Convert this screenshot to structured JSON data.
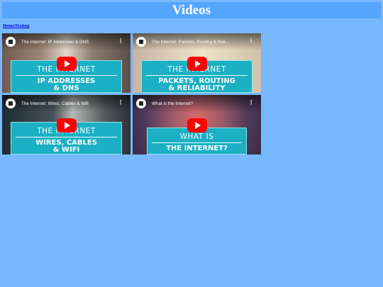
{
  "page": {
    "title": "Videos"
  },
  "nav": {
    "links": [
      "Home",
      "Texting"
    ]
  },
  "videos": [
    {
      "title": "The Internet: IP Addresses & DNS",
      "card_top": "THE INTERNET",
      "card_main_1": "IP ADDRESSES",
      "card_main_2": "& DNS"
    },
    {
      "title": "The Internet: Packets, Routing & Reli...",
      "card_top": "THE INTERNET",
      "card_main_1": "PACKETS, ROUTING",
      "card_main_2": "& RELIABILITY"
    },
    {
      "title": "The Internet: Wires, Cables & Wifi",
      "card_top": "THE INTERNET",
      "card_main_1": "WIRES, CABLES",
      "card_main_2": "& WIFI"
    },
    {
      "title": "What is the Internet?",
      "card_top": "WHAT IS",
      "card_main_1": "THE INTERNET?",
      "card_main_2": ""
    }
  ],
  "icons": {
    "play": "youtube-play-icon",
    "menu": "more-vert-icon",
    "channel": "channel-avatar-icon"
  },
  "colors": {
    "background": "#77b8ff",
    "header": "#55a5ff",
    "play": "#ff0000",
    "card": "#1bb0c4"
  }
}
